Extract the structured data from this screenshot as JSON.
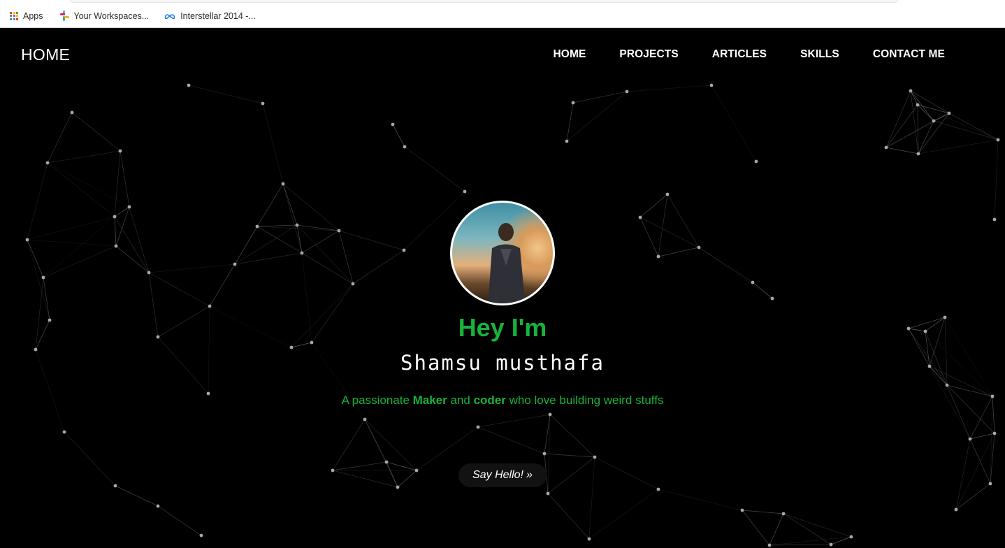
{
  "bookmarks": [
    {
      "label": "Apps",
      "icon": "apps-grid-icon"
    },
    {
      "label": "Your Workspaces...",
      "icon": "slack-icon"
    },
    {
      "label": "Interstellar 2014 -...",
      "icon": "meta-icon"
    }
  ],
  "nav": {
    "brand": "HOME",
    "items": [
      "HOME",
      "PROJECTS",
      "ARTICLES",
      "SKILLS",
      "CONTACT ME"
    ]
  },
  "hero": {
    "greeting": "Hey I'm",
    "name": "Shamsu musthafa",
    "tagline": {
      "part1": "A passionate ",
      "strong1": "Maker",
      "part2": " and ",
      "strong2": "coder",
      "part3": " who love building weird stuffs"
    },
    "cta_label": "Say Hello!",
    "cta_icon": "double-chevron-right-icon"
  },
  "colors": {
    "accent_green": "#17b33a",
    "background": "#000000",
    "network_line": "#9a9a9a"
  }
}
